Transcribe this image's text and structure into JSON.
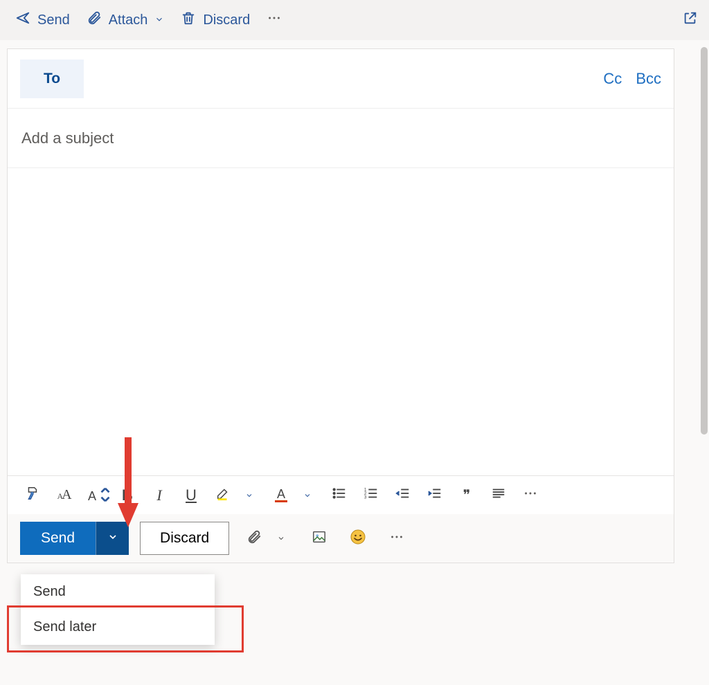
{
  "top_toolbar": {
    "send": "Send",
    "attach": "Attach",
    "discard": "Discard"
  },
  "to": {
    "button": "To",
    "cc": "Cc",
    "bcc": "Bcc"
  },
  "subject_placeholder": "Add a subject",
  "body_text": "",
  "format_bar": {
    "bold": "B",
    "italic": "I",
    "underline": "U",
    "font_color_glyph": "A",
    "quote": "❞"
  },
  "bottom_bar": {
    "send": "Send",
    "discard": "Discard"
  },
  "send_menu": {
    "items": [
      "Send",
      "Send later"
    ]
  },
  "icons": {
    "send_arrow": "send-icon",
    "paperclip": "paperclip-icon",
    "chevron_down": "chevron-down-icon",
    "trash": "trash-icon",
    "more": "more-icon",
    "popout": "popout-icon",
    "format_painter": "format-painter-icon",
    "font_size": "font-size-icon",
    "font_scale": "font-scale-icon",
    "highlight": "highlight-icon",
    "bullets": "bullets-icon",
    "numbers": "numbers-icon",
    "outdent": "outdent-icon",
    "indent": "indent-icon",
    "paragraph": "paragraph-icon",
    "image": "image-icon",
    "emoji": "emoji-icon"
  },
  "colors": {
    "app_blue": "#2b579a",
    "send_blue": "#0f6cbd",
    "highlight_yellow": "#ffe600",
    "font_red": "#d83b01",
    "annotation_red": "#e03c31"
  }
}
